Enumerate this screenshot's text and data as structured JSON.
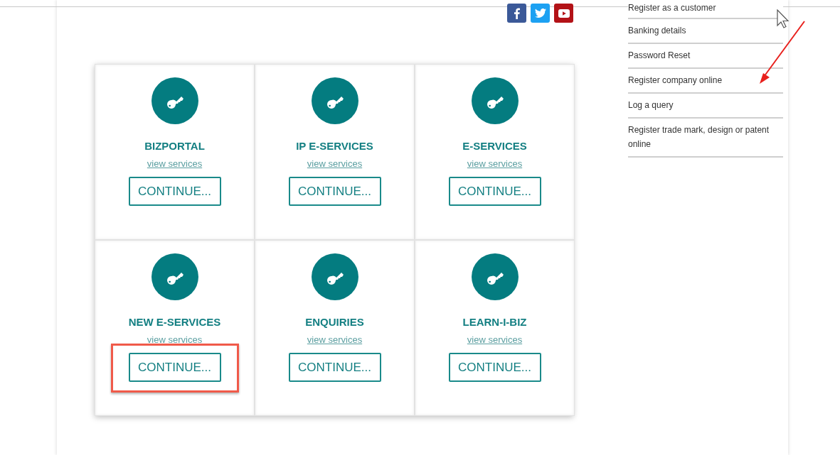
{
  "social_links": [
    {
      "kind": "facebook",
      "color": "#3b5998"
    },
    {
      "kind": "twitter",
      "color": "#1da1f2"
    },
    {
      "kind": "youtube",
      "color": "#b31217"
    }
  ],
  "cards": [
    {
      "title": "BIZPORTAL",
      "link": "view services",
      "button": "CONTINUE...",
      "highlighted": false
    },
    {
      "title": "IP E-SERVICES",
      "link": "view services",
      "button": "CONTINUE...",
      "highlighted": false
    },
    {
      "title": "E-SERVICES",
      "link": "view services",
      "button": "CONTINUE...",
      "highlighted": false
    },
    {
      "title": "NEW E-SERVICES",
      "link": "view services",
      "button": "CONTINUE...",
      "highlighted": true
    },
    {
      "title": "ENQUIRIES",
      "link": "view services",
      "button": "CONTINUE...",
      "highlighted": false
    },
    {
      "title": "LEARN-I-BIZ",
      "link": "view services",
      "button": "CONTINUE...",
      "highlighted": false
    }
  ],
  "sidebar": {
    "items": [
      "Register as a customer",
      "Banking details",
      "Password Reset",
      "Register company online",
      "Log a query",
      "Register trade mark, design or patent online"
    ]
  }
}
